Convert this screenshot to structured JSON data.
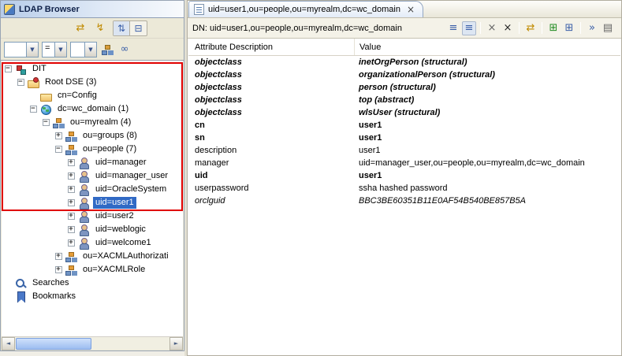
{
  "icons": {
    "combo_arrow": "▼",
    "glasses": "∞",
    "scroll_left": "◄",
    "scroll_right": "►"
  },
  "left_panel": {
    "title": "LDAP Browser",
    "toolbar": {
      "refresh": "⇄",
      "quick_search": "↯",
      "link_with_editor": "⇅",
      "collapse_all": "⊟"
    },
    "search": {
      "attribute": "",
      "operator": "=",
      "value": ""
    },
    "tree": [
      {
        "depth": 0,
        "expander": "−",
        "icon": "dit-icon",
        "label": "DIT"
      },
      {
        "depth": 1,
        "expander": "−",
        "icon": "rootdse-icon",
        "label": "Root DSE (3)"
      },
      {
        "depth": 2,
        "expander": "",
        "icon": "folder-icon",
        "label": "cn=Config"
      },
      {
        "depth": 2,
        "expander": "−",
        "icon": "domain-icon",
        "label": "dc=wc_domain (1)"
      },
      {
        "depth": 3,
        "expander": "−",
        "icon": "orgunit-icon",
        "label": "ou=myrealm (4)"
      },
      {
        "depth": 4,
        "expander": "+",
        "icon": "orgunit-icon",
        "label": "ou=groups (8)"
      },
      {
        "depth": 4,
        "expander": "−",
        "icon": "orgunit-icon",
        "label": "ou=people (7)"
      },
      {
        "depth": 5,
        "expander": "+",
        "icon": "person-icon",
        "label": "uid=manager"
      },
      {
        "depth": 5,
        "expander": "+",
        "icon": "person-icon",
        "label": "uid=manager_user"
      },
      {
        "depth": 5,
        "expander": "+",
        "icon": "person-icon",
        "label": "uid=OracleSystem"
      },
      {
        "depth": 5,
        "expander": "+",
        "icon": "person-icon",
        "label": "uid=user1",
        "selected": true
      },
      {
        "depth": 5,
        "expander": "+",
        "icon": "person-icon",
        "label": "uid=user2"
      },
      {
        "depth": 5,
        "expander": "+",
        "icon": "person-icon",
        "label": "uid=weblogic"
      },
      {
        "depth": 5,
        "expander": "+",
        "icon": "person-icon",
        "label": "uid=welcome1"
      },
      {
        "depth": 4,
        "expander": "+",
        "icon": "orgunit-icon",
        "label": "ou=XACMLAuthorizati"
      },
      {
        "depth": 4,
        "expander": "+",
        "icon": "orgunit-icon",
        "label": "ou=XACMLRole"
      },
      {
        "depth": 0,
        "expander": "",
        "icon": "search-icon",
        "label": "Searches"
      },
      {
        "depth": 0,
        "expander": "",
        "icon": "bookmark-icon",
        "label": "Bookmarks"
      }
    ]
  },
  "right_panel": {
    "tab": {
      "title": "uid=user1,ou=people,ou=myrealm,dc=wc_domain",
      "close": "×"
    },
    "dn": "DN: uid=user1,ou=people,ou=myrealm,dc=wc_domain",
    "toolbar_icons": [
      {
        "name": "quick-filter-icon",
        "glyph": "≡",
        "color": "blue"
      },
      {
        "name": "show-operational-attributes-icon",
        "glyph": "≡",
        "color": "blue",
        "pressed": true
      },
      {
        "name": "separator"
      },
      {
        "name": "delete-value-icon",
        "glyph": "×",
        "color": "gray"
      },
      {
        "name": "delete-all-values-icon",
        "glyph": "×",
        "color": "dark"
      },
      {
        "name": "separator"
      },
      {
        "name": "refresh-attributes-icon",
        "glyph": "⇄",
        "color": "gold"
      },
      {
        "name": "separator"
      },
      {
        "name": "new-value-icon",
        "glyph": "⊞",
        "color": "green"
      },
      {
        "name": "new-attribute-icon",
        "glyph": "⊞",
        "color": "blue"
      },
      {
        "name": "separator"
      },
      {
        "name": "expand-editor-icon",
        "glyph": "»",
        "color": "blue"
      },
      {
        "name": "view-menu-icon",
        "glyph": "▤",
        "color": "gray"
      }
    ],
    "table": {
      "columns": [
        "Attribute Description",
        "Value"
      ],
      "rows": [
        {
          "attr": "objectclass",
          "value": "inetOrgPerson (structural)",
          "style": "bold italic"
        },
        {
          "attr": "objectclass",
          "value": "organizationalPerson (structural)",
          "style": "bold italic"
        },
        {
          "attr": "objectclass",
          "value": "person (structural)",
          "style": "bold italic"
        },
        {
          "attr": "objectclass",
          "value": "top (abstract)",
          "style": "bold italic"
        },
        {
          "attr": "objectclass",
          "value": "wlsUser (structural)",
          "style": "bold italic"
        },
        {
          "attr": "cn",
          "value": "user1",
          "style": "bold"
        },
        {
          "attr": "sn",
          "value": "user1",
          "style": "bold"
        },
        {
          "attr": "description",
          "value": "user1",
          "style": ""
        },
        {
          "attr": "manager",
          "value": "uid=manager_user,ou=people,ou=myrealm,dc=wc_domain",
          "style": ""
        },
        {
          "attr": "uid",
          "value": "user1",
          "style": "bold"
        },
        {
          "attr": "userpassword",
          "value": "ssha hashed password",
          "style": ""
        },
        {
          "attr": "orclguid",
          "value": "BBC3BE60351B11E0AF54B540BE857B5A",
          "style": "italic"
        }
      ]
    }
  }
}
